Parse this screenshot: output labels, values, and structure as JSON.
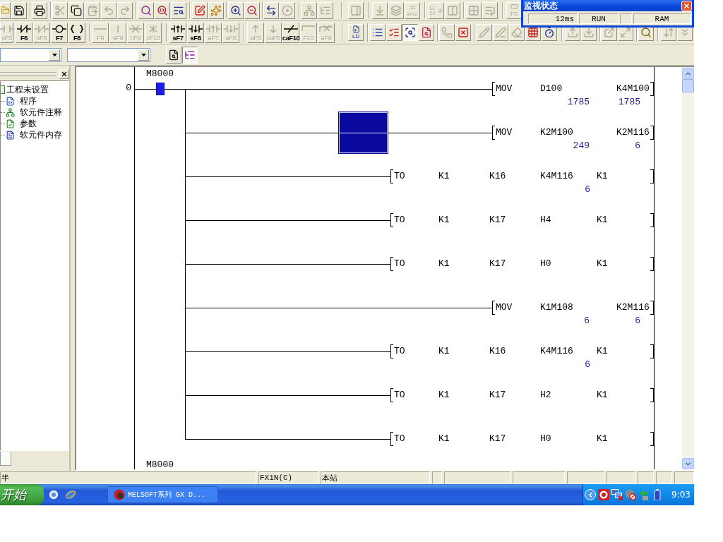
{
  "toolbar_1": {
    "buttons": [
      {
        "kind": "open",
        "disabled": false
      },
      {
        "kind": "save",
        "disabled": false
      },
      {
        "kind": "separator"
      },
      {
        "kind": "print",
        "disabled": false
      },
      {
        "kind": "separator"
      },
      {
        "kind": "cut",
        "disabled": true
      },
      {
        "kind": "copy",
        "disabled": false
      },
      {
        "kind": "paste",
        "disabled": true
      },
      {
        "kind": "undo",
        "disabled": true
      },
      {
        "kind": "redo",
        "disabled": true
      },
      {
        "kind": "separator"
      },
      {
        "kind": "finddevice",
        "disabled": false
      },
      {
        "kind": "findinstruction",
        "disabled": false
      },
      {
        "kind": "findtext",
        "disabled": false
      },
      {
        "kind": "separator"
      },
      {
        "kind": "comment",
        "disabled": false
      },
      {
        "kind": "sparkle",
        "disabled": false
      },
      {
        "kind": "separator"
      },
      {
        "kind": "zoomin",
        "disabled": false
      },
      {
        "kind": "zoomout",
        "disabled": false
      },
      {
        "kind": "separator"
      },
      {
        "kind": "switch",
        "disabled": false
      },
      {
        "kind": "disc",
        "disabled": true
      },
      {
        "kind": "separator"
      },
      {
        "kind": "network",
        "disabled": true
      },
      {
        "kind": "listtree",
        "disabled": true
      },
      {
        "kind": "separator"
      },
      {
        "kind": "panel",
        "disabled": true
      },
      {
        "kind": "separator"
      },
      {
        "kind": "download",
        "disabled": true
      },
      {
        "kind": "layers",
        "disabled": true
      },
      {
        "kind": "error",
        "label": "error",
        "disabled": true
      },
      {
        "kind": "separator"
      },
      {
        "kind": "sort",
        "label": "S1 S9",
        "disabled": true
      },
      {
        "kind": "columns",
        "disabled": true
      },
      {
        "kind": "separator"
      },
      {
        "kind": "grid",
        "disabled": true
      },
      {
        "kind": "listend",
        "disabled": true
      },
      {
        "kind": "separator"
      },
      {
        "kind": "key",
        "label": "F5",
        "disabled": true
      }
    ]
  },
  "toolbar_2": {
    "function_keys": [
      {
        "kind": "no",
        "label": "sF5",
        "disabled": true
      },
      {
        "kind": "nc",
        "label": "F6",
        "disabled": false
      },
      {
        "kind": "nc",
        "label": "sF6",
        "disabled": true
      },
      {
        "kind": "coil",
        "label": "F7",
        "disabled": false
      },
      {
        "kind": "app",
        "label": "F8",
        "disabled": false
      },
      {
        "kind": "separator"
      },
      {
        "kind": "hline",
        "label": "F9",
        "disabled": true
      },
      {
        "kind": "vline",
        "label": "sF9",
        "disabled": true
      },
      {
        "kind": "delh",
        "label": "cF9",
        "disabled": true
      },
      {
        "kind": "delv",
        "label": "cF10",
        "disabled": true
      },
      {
        "kind": "separator"
      },
      {
        "kind": "rise",
        "label": "sF7",
        "disabled": false
      },
      {
        "kind": "fall",
        "label": "sF8",
        "disabled": false
      },
      {
        "kind": "rise",
        "label": "aF7",
        "disabled": true
      },
      {
        "kind": "fall",
        "label": "aF8",
        "disabled": true
      },
      {
        "kind": "separator"
      },
      {
        "kind": "up",
        "label": "aF5",
        "disabled": true
      },
      {
        "kind": "down",
        "label": "caF5",
        "disabled": true
      },
      {
        "kind": "invert",
        "label": "caF10",
        "disabled": false
      },
      {
        "kind": "draw",
        "label": "F10",
        "disabled": true
      },
      {
        "kind": "erase",
        "label": "aF9",
        "disabled": true
      }
    ],
    "buttons": [
      {
        "kind": "readmode",
        "label": "LD",
        "disabled": false,
        "pressed": false
      },
      {
        "kind": "separator"
      },
      {
        "kind": "list",
        "disabled": false,
        "pressed": false
      },
      {
        "kind": "listedit",
        "disabled": false,
        "pressed": false
      },
      {
        "kind": "monitor",
        "disabled": false,
        "pressed": true
      },
      {
        "kind": "monitoredit",
        "disabled": false,
        "pressed": false
      },
      {
        "kind": "separator"
      },
      {
        "kind": "phone",
        "disabled": true,
        "pressed": false
      },
      {
        "kind": "stop",
        "disabled": false,
        "pressed": false
      },
      {
        "kind": "separator"
      },
      {
        "kind": "pencil",
        "disabled": true,
        "pressed": false
      },
      {
        "kind": "penline",
        "disabled": true,
        "pressed": false
      },
      {
        "kind": "eraser",
        "disabled": true,
        "pressed": false
      },
      {
        "kind": "devicegrid",
        "disabled": false,
        "pressed": false
      },
      {
        "kind": "timer",
        "disabled": false,
        "pressed": false
      },
      {
        "kind": "separator"
      },
      {
        "kind": "upload",
        "disabled": true,
        "pressed": false
      },
      {
        "kind": "download2",
        "disabled": true,
        "pressed": false
      },
      {
        "kind": "separator"
      },
      {
        "kind": "popout",
        "disabled": true,
        "pressed": false
      },
      {
        "kind": "expand",
        "disabled": true,
        "pressed": false
      },
      {
        "kind": "separator"
      },
      {
        "kind": "trace",
        "disabled": false,
        "pressed": false
      },
      {
        "kind": "separator"
      },
      {
        "kind": "stepa",
        "disabled": true,
        "pressed": false
      },
      {
        "kind": "stepb",
        "disabled": true,
        "pressed": false
      }
    ]
  },
  "toolbar_3": {
    "items": [
      {
        "kind": "combo"
      },
      {
        "kind": "combo"
      },
      {
        "kind": "header",
        "pressed": false
      },
      {
        "kind": "tree",
        "pressed": true
      }
    ]
  },
  "monitor_window": {
    "title": "监视状态",
    "fields": [
      {
        "kind": "scantime",
        "text": "12ms"
      },
      {
        "kind": "status",
        "text": "RUN"
      },
      {
        "kind": "blank"
      },
      {
        "kind": "memory",
        "text": "RAM"
      }
    ]
  },
  "project_panel": {
    "tree": [
      {
        "label": "工程未设置",
        "kind": "project",
        "children": [
          {
            "label": "程序",
            "kind": "program"
          },
          {
            "label": "软元件注释",
            "kind": "comment"
          },
          {
            "label": "参数",
            "kind": "parameter"
          },
          {
            "label": "软元件内存",
            "kind": "memory"
          }
        ]
      }
    ]
  },
  "ladder": {
    "rungs": [
      {
        "step": "0",
        "contact": {
          "device": "M8000",
          "on": true
        },
        "branches": [
          {
            "instruction": "MOV",
            "operands": [
              {
                "device": "D100",
                "value": "1785"
              },
              {
                "device": "K4M100",
                "value": "1785"
              }
            ],
            "selected": false
          },
          {
            "instruction": "MOV",
            "operands": [
              {
                "device": "K2M100",
                "value": "249"
              },
              {
                "device": "K2M116",
                "value": "6"
              }
            ],
            "selected": true
          },
          {
            "instruction": "TO",
            "operands": [
              {
                "device": "K1"
              },
              {
                "device": "K16"
              },
              {
                "device": "K4M116",
                "value": "6"
              },
              {
                "device": "K1"
              }
            ],
            "selected": false
          },
          {
            "instruction": "TO",
            "operands": [
              {
                "device": "K1"
              },
              {
                "device": "K17"
              },
              {
                "device": "H4"
              },
              {
                "device": "K1"
              }
            ],
            "selected": false
          },
          {
            "instruction": "TO",
            "operands": [
              {
                "device": "K1"
              },
              {
                "device": "K17"
              },
              {
                "device": "H0"
              },
              {
                "device": "K1"
              }
            ],
            "selected": false
          },
          {
            "instruction": "MOV",
            "operands": [
              {
                "device": "K1M108",
                "value": "6"
              },
              {
                "device": "K2M116",
                "value": "6"
              }
            ],
            "selected": false
          },
          {
            "instruction": "TO",
            "operands": [
              {
                "device": "K1"
              },
              {
                "device": "K16"
              },
              {
                "device": "K4M116",
                "value": "6"
              },
              {
                "device": "K1"
              }
            ],
            "selected": false
          },
          {
            "instruction": "TO",
            "operands": [
              {
                "device": "K1"
              },
              {
                "device": "K17"
              },
              {
                "device": "H2"
              },
              {
                "device": "K1"
              }
            ],
            "selected": false
          },
          {
            "instruction": "TO",
            "operands": [
              {
                "device": "K1"
              },
              {
                "device": "K17"
              },
              {
                "device": "H0"
              },
              {
                "device": "K1"
              }
            ],
            "selected": false
          }
        ]
      },
      {
        "contact": {
          "device": "M8000"
        }
      }
    ]
  },
  "status_bar": {
    "panels": [
      "半",
      "FX1N(C)",
      "本站"
    ]
  },
  "taskbar": {
    "start_button": "开始",
    "tasks": [
      {
        "label": "MELSOFT系列 GX D...",
        "selected": false
      }
    ],
    "clock": "9:03"
  }
}
